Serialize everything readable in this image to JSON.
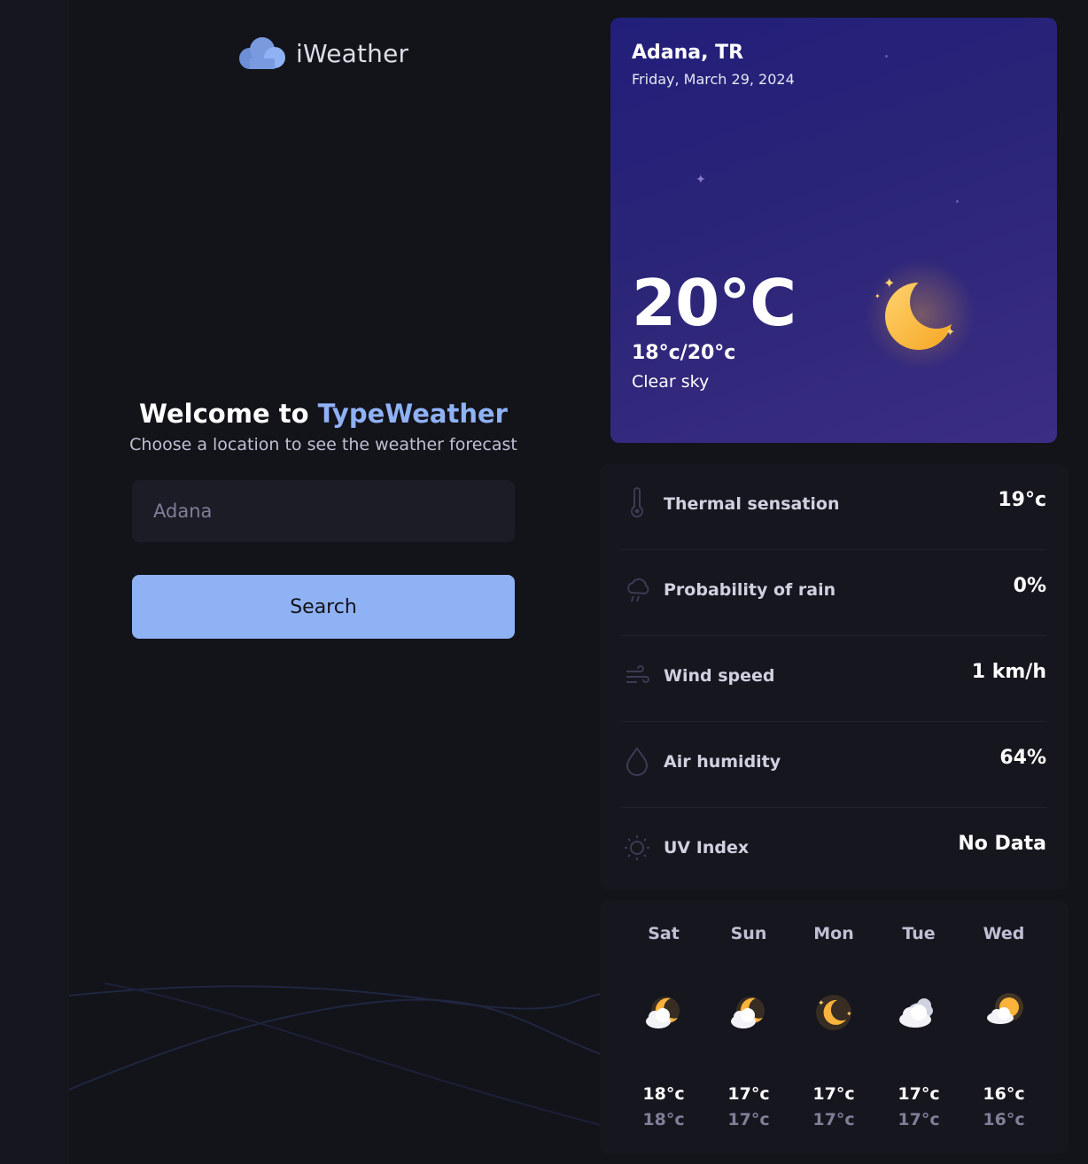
{
  "app": {
    "name": "iWeather"
  },
  "welcome": {
    "prefix": "Welcome to ",
    "brand": "TypeWeather",
    "subtitle": "Choose a location to see the weather forecast"
  },
  "search": {
    "value": "Adana",
    "button_label": "Search"
  },
  "today": {
    "city": "Adana, TR",
    "date": "Friday, March 29, 2024",
    "temperature": "20°C",
    "range": "18°c/20°c",
    "description": "Clear sky",
    "icon": "crescent-moon-icon"
  },
  "details": [
    {
      "label": "Thermal sensation",
      "value": "19°c",
      "icon": "thermometer-icon"
    },
    {
      "label": "Probability of rain",
      "value": "0%",
      "icon": "cloud-rain-icon"
    },
    {
      "label": "Wind speed",
      "value": "1 km/h",
      "icon": "wind-icon"
    },
    {
      "label": "Air humidity",
      "value": "64%",
      "icon": "drop-icon"
    },
    {
      "label": "UV Index",
      "value": "No Data",
      "icon": "sun-icon"
    }
  ],
  "forecast": [
    {
      "day": "Sat",
      "max": "18°c",
      "min": "18°c",
      "icon": "cloudy-night-icon"
    },
    {
      "day": "Sun",
      "max": "17°c",
      "min": "17°c",
      "icon": "cloudy-night-icon"
    },
    {
      "day": "Mon",
      "max": "17°c",
      "min": "17°c",
      "icon": "moon-icon"
    },
    {
      "day": "Tue",
      "max": "17°c",
      "min": "17°c",
      "icon": "cloudy-icon"
    },
    {
      "day": "Wed",
      "max": "16°c",
      "min": "16°c",
      "icon": "partly-sunny-icon"
    }
  ],
  "colors": {
    "accent": "#8fb2f5",
    "background": "#13131a",
    "panel": "#16161f",
    "moon": "#fbb33c"
  }
}
